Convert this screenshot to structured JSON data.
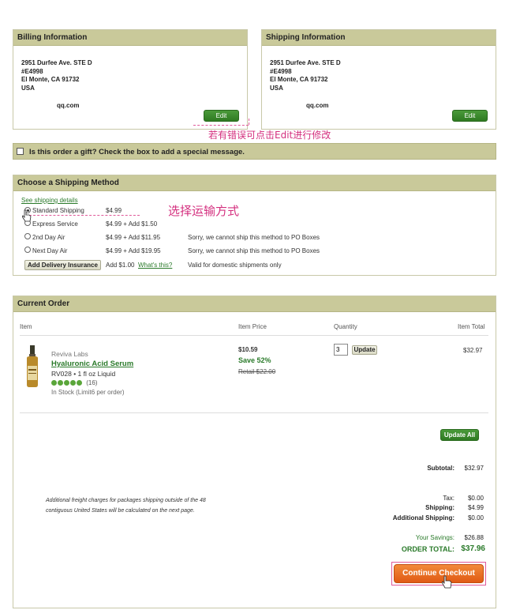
{
  "billing": {
    "title": "Billing Information",
    "line1": "2951 Durfee Ave. STE D",
    "line2": "#E4998",
    "line3": "El Monte, CA 91732",
    "line4": "USA",
    "email": "qq.com",
    "edit_label": "Edit"
  },
  "shipping": {
    "title": "Shipping Information",
    "line1": "2951 Durfee Ave. STE D",
    "line2": "#E4998",
    "line3": "El Monte, CA 91732",
    "line4": "USA",
    "email": "qq.com",
    "edit_label": "Edit"
  },
  "annotations": {
    "edit_note": "若有错误可点击Edit进行修改",
    "shipping_note": "选择运输方式"
  },
  "gift": {
    "label": "Is this order a gift? Check the box to add a special message."
  },
  "shipping_method": {
    "title": "Choose a Shipping Method",
    "details_link": "See shipping details",
    "options": [
      {
        "name": "Standard Shipping",
        "price": "$4.99",
        "note": "",
        "selected": true
      },
      {
        "name": "Express Service",
        "price": "$4.99 + Add $1.50",
        "note": "",
        "selected": false
      },
      {
        "name": "2nd Day Air",
        "price": "$4.99 + Add $11.95",
        "note": "Sorry, we cannot ship this method to PO Boxes",
        "selected": false
      },
      {
        "name": "Next Day Air",
        "price": "$4.99 + Add $19.95",
        "note": "Sorry, we cannot ship this method to PO Boxes",
        "selected": false
      }
    ],
    "insurance_button": "Add Delivery Insurance",
    "insurance_price": "Add $1.00",
    "insurance_link": "What's this?",
    "insurance_note": "Valid for domestic shipments only"
  },
  "order": {
    "title": "Current Order",
    "columns": {
      "item": "Item",
      "price": "Item Price",
      "quantity": "Quantity",
      "total": "Item Total"
    },
    "product": {
      "brand": "Reviva Labs",
      "name": "Hyaluronic Acid Serum",
      "sku": "RV028 • 1 fl oz Liquid",
      "rating": 5,
      "reviews": "(16)",
      "stock": "In Stock",
      "limit": "(Limit6 per order)",
      "price": "$10.59",
      "save": "Save 52%",
      "retail": "Retail $22.00",
      "quantity": "3",
      "update_label": "Update",
      "total": "$32.97"
    },
    "update_all_label": "Update All",
    "subtotal_label": "Subtotal:",
    "subtotal": "$32.97",
    "freight_note_1": "Additional freight charges for packages shipping outside of the 48",
    "freight_note_2": "contiguous United States will be calculated on the next page.",
    "tax_label": "Tax:",
    "tax": "$0.00",
    "shipping_label": "Shipping:",
    "shipping": "$4.99",
    "addl_shipping_label": "Additional Shipping:",
    "addl_shipping": "$0.00",
    "savings_label": "Your Savings:",
    "savings": "$26.88",
    "order_total_label": "ORDER TOTAL:",
    "order_total": "$37.96",
    "checkout_label": "Continue Checkout"
  },
  "colors": {
    "panel_header": "#c9c99a",
    "accent_green": "#2f7a22",
    "checkout_orange": "#e8641e",
    "annotation_pink": "#d4307f"
  }
}
